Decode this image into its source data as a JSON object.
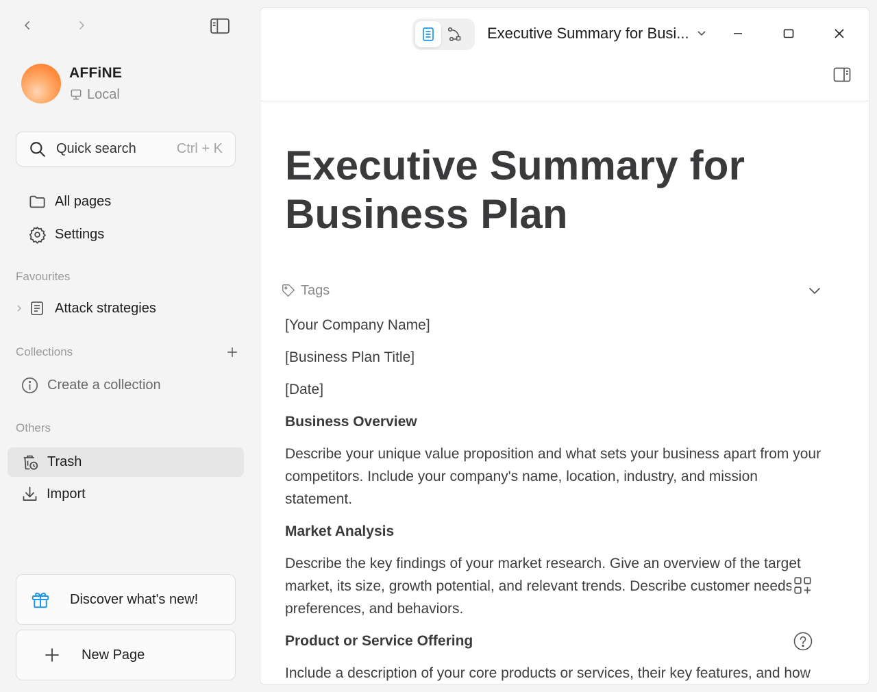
{
  "workspace": {
    "name": "AFFiNE",
    "type": "Local"
  },
  "search": {
    "label": "Quick search",
    "shortcut": "Ctrl + K"
  },
  "menu": {
    "all_pages": "All pages",
    "settings": "Settings"
  },
  "sections": {
    "favourites": "Favourites",
    "collections": "Collections",
    "others": "Others"
  },
  "favourites": [
    {
      "label": "Attack strategies"
    }
  ],
  "collections": {
    "create_label": "Create a collection"
  },
  "others": {
    "trash": "Trash",
    "import": "Import"
  },
  "bottom": {
    "discover": "Discover what's new!",
    "new_page": "New Page"
  },
  "header": {
    "doc_title": "Executive Summary for Busi..."
  },
  "document": {
    "title": "Executive Summary for Business Plan",
    "tags_label": "Tags",
    "lines": {
      "company": "[Your Company Name]",
      "plan_title": "[Business Plan Title]",
      "date": "[Date]",
      "h_overview": "Business Overview",
      "p_overview": "Describe your unique value proposition and what sets your business apart from your competitors. Include your company's name, location, industry, and mission statement.",
      "h_market": "Market Analysis",
      "p_market": "Describe the key findings of your market research. Give an overview of the target market, its size, growth potential, and relevant trends. Describe customer needs, preferences, and behaviors.",
      "h_product": "Product or Service Offering",
      "p_product": "Include a description of your core products or services, their key features, and how they meet customer needs."
    }
  },
  "colors": {
    "accent": "#1e96eb",
    "sidebar_bg": "#f4f4f4",
    "active_item_bg": "#e6e6e6"
  }
}
